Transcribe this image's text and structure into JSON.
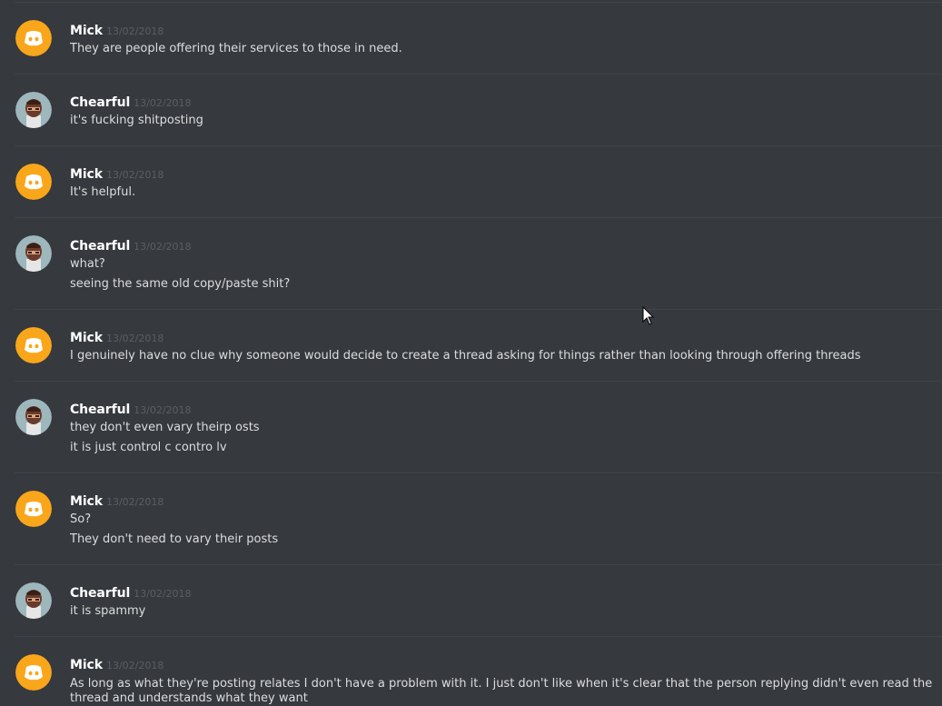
{
  "messages": [
    {
      "author": "Mick",
      "timestamp": "13/02/2018",
      "avatar": "discord-default-orange",
      "lines": [
        "They are people offering their services to those in need."
      ]
    },
    {
      "author": "Chearful",
      "timestamp": "13/02/2018",
      "avatar": "bearded-character",
      "lines": [
        "it's fucking shitposting"
      ]
    },
    {
      "author": "Mick",
      "timestamp": "13/02/2018",
      "avatar": "discord-default-orange",
      "lines": [
        "It's helpful."
      ]
    },
    {
      "author": "Chearful",
      "timestamp": "13/02/2018",
      "avatar": "bearded-character",
      "lines": [
        "what?",
        "seeing the same old copy/paste shit?"
      ]
    },
    {
      "author": "Mick",
      "timestamp": "13/02/2018",
      "avatar": "discord-default-orange",
      "lines": [
        "I genuinely have no clue why someone would decide to create a thread asking for things rather than looking through offering threads"
      ]
    },
    {
      "author": "Chearful",
      "timestamp": "13/02/2018",
      "avatar": "bearded-character",
      "lines": [
        "they don't even vary theirp osts",
        "it is just control c contro lv"
      ]
    },
    {
      "author": "Mick",
      "timestamp": "13/02/2018",
      "avatar": "discord-default-orange",
      "lines": [
        "So?",
        "They don't need to vary their posts"
      ]
    },
    {
      "author": "Chearful",
      "timestamp": "13/02/2018",
      "avatar": "bearded-character",
      "lines": [
        "it is spammy"
      ]
    },
    {
      "author": "Mick",
      "timestamp": "13/02/2018",
      "avatar": "discord-default-orange",
      "lines": [
        "As long as what they're posting relates I don't have a problem with it. I just don't like when it's clear that the person replying didn't even read the thread and understands what they want"
      ]
    }
  ],
  "colors": {
    "background": "#36393e",
    "author": "#ffffff",
    "timestamp": "#5b5e63",
    "text": "#dcddde",
    "divider": "#40444b",
    "discord_orange": "#faa61a"
  }
}
